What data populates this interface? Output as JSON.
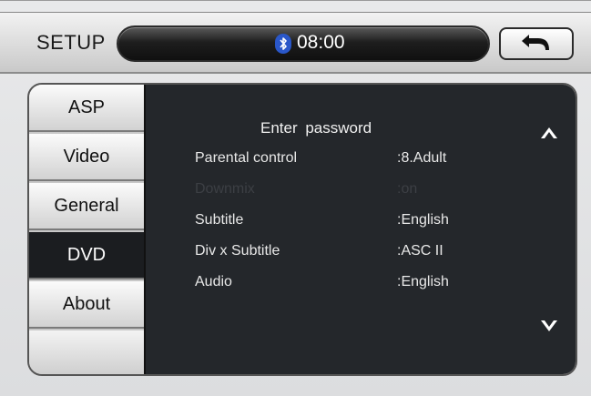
{
  "header": {
    "title": "SETUP",
    "time": "08:00",
    "bluetooth_icon": "bluetooth-icon",
    "back_icon": "back-arrow-icon"
  },
  "tabs": [
    {
      "label": "ASP",
      "active": false
    },
    {
      "label": "Video",
      "active": false
    },
    {
      "label": "General",
      "active": false
    },
    {
      "label": "DVD",
      "active": true
    },
    {
      "label": "About",
      "active": false
    },
    {
      "label": "",
      "active": false
    }
  ],
  "content": {
    "enter_password": "Enter password",
    "rows": [
      {
        "label": "Parental control",
        "value": ":8.Adult",
        "enabled": true
      },
      {
        "label": "Downmix",
        "value": ":on",
        "enabled": false
      },
      {
        "label": "Subtitle",
        "value": ":English",
        "enabled": true
      },
      {
        "label": "Div x Subtitle",
        "value": ":ASC II",
        "enabled": true
      },
      {
        "label": "Audio",
        "value": ":English",
        "enabled": true
      }
    ],
    "scroll_up_icon": "chevron-up-icon",
    "scroll_down_icon": "chevron-down-icon"
  },
  "colors": {
    "active_tab": "#1b1d20",
    "content_bg": "#24272b",
    "bluetooth": "#2a57c9"
  }
}
